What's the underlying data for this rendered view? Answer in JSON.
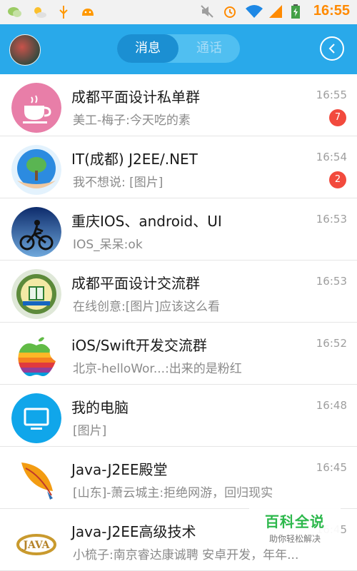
{
  "status_bar": {
    "time": "16:55"
  },
  "header": {
    "tabs": [
      {
        "label": "消息",
        "active": true
      },
      {
        "label": "通话",
        "active": false
      }
    ]
  },
  "conversations": [
    {
      "name": "成都平面设计私单群",
      "preview": "美工-梅子:今天吃的素",
      "time": "16:55",
      "unread": "7"
    },
    {
      "name": "IT(成都) J2EE/.NET",
      "preview": "我不想说: [图片]",
      "time": "16:54",
      "unread": "2"
    },
    {
      "name": "重庆IOS、android、UI",
      "preview": "IOS_呆呆:ok",
      "time": "16:53"
    },
    {
      "name": "成都平面设计交流群",
      "preview": "在线创意:[图片]应该这么看",
      "time": "16:53"
    },
    {
      "name": "iOS/Swift开发交流群",
      "preview": "北京-helloWor...:出来的是粉红",
      "time": "16:52"
    },
    {
      "name": "我的电脑",
      "preview": "[图片]",
      "time": "16:48"
    },
    {
      "name": "Java-J2EE殿堂",
      "preview": "[山东]-萧云城主:拒绝网游，回归现实",
      "time": "16:45"
    },
    {
      "name": "Java-J2EE高级技术",
      "preview": "小梳子:南京睿达康诚聘   安卓开发，年年...",
      "time": "16:45"
    }
  ],
  "watermark": {
    "title": "百科全说",
    "subtitle": "助你轻松解决"
  },
  "colors": {
    "header": "#29a9ea",
    "active_tab": "#1b8fd2",
    "badge": "#f24a3d",
    "clock": "#ff8a00"
  }
}
